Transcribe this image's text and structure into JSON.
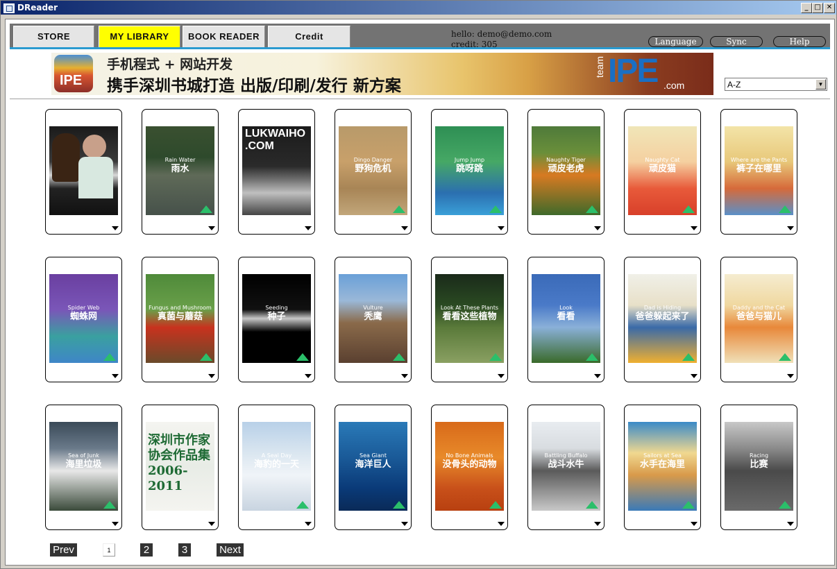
{
  "window": {
    "title": "DReader"
  },
  "nav": {
    "tabs": [
      {
        "label": "STORE",
        "active": false
      },
      {
        "label": "MY LIBRARY",
        "active": true
      },
      {
        "label": "BOOK READER",
        "active": false
      },
      {
        "label": "Credit",
        "active": false
      }
    ]
  },
  "user": {
    "hello": "hello: demo@demo.com",
    "credit": "credit: 305"
  },
  "actions": {
    "language": "Language",
    "sync": "Sync",
    "help": "Help"
  },
  "banner": {
    "logo_text": "IPE",
    "line1": "手机程式 + 网站开发",
    "line2": "携手深圳书城打造 出版/印刷/发行 新方案",
    "brand_team": "team",
    "brand_ipe": "IPE",
    "brand_com": ".com"
  },
  "sort": {
    "selected": "A-Z"
  },
  "books": [
    {
      "en": "",
      "cn": "",
      "bg": "linear-gradient(#1a1a1a,#3a3a3a 40%,#d8d8d8 55%,#222 70%,#111)",
      "special": "horse"
    },
    {
      "en": "Rain Water",
      "cn": "雨水",
      "bg": "linear-gradient(#3a5030,#2e4a2c 35%,#5f6a58 55%,#46514a)"
    },
    {
      "en": "",
      "cn": "",
      "bg": "linear-gradient(#1b1b1b,#2a2a2a 45%,#707070 60%,#bfbfbf 75%,#444)",
      "special": "lukwaiho"
    },
    {
      "en": "Dingo Danger",
      "cn": "野狗危机",
      "bg": "linear-gradient(#b89a6a,#c8a06a 40%,#a88556 70%,#c1a67a)"
    },
    {
      "en": "Jump Jump",
      "cn": "跳呀跳",
      "bg": "linear-gradient(#2e8f54,#46a865 40%,#2b6fb0 75%,#3aa0d8)"
    },
    {
      "en": "Naughty Tiger",
      "cn": "顽皮老虎",
      "bg": "linear-gradient(#4f7a3a,#6a8f3a 30%,#d77a22 55%,#3f6a2a)"
    },
    {
      "en": "Naughty Cat",
      "cn": "顽皮猫",
      "bg": "linear-gradient(#f0e6b8,#f5d0a0 40%,#e85a3a 70%,#d8402a)"
    },
    {
      "en": "Where are the Pants",
      "cn": "裤子在哪里",
      "bg": "linear-gradient(#f3e4a8,#e8c87a 40%,#d66a3a 70%,#5a8fc8)"
    },
    {
      "en": "Spider Web",
      "cn": "蜘蛛网",
      "bg": "linear-gradient(#6a3fa0,#7a56b8 40%,#3aa0a0 70%,#3f86c8)"
    },
    {
      "en": "Fungus and Mushroom",
      "cn": "真菌与蘑菇",
      "bg": "linear-gradient(#4f8a3a,#6aa04a 40%,#c8321e 60%,#6a4a2a)"
    },
    {
      "en": "Seeding",
      "cn": "种子",
      "bg": "linear-gradient(#000,#111 40%,#c8c8c8 50%,#000 65%)"
    },
    {
      "en": "Vulture",
      "cn": "秃鹰",
      "bg": "linear-gradient(#6aa0d8,#9ab8d8 30%,#8a6a4a 55%,#5a4030)"
    },
    {
      "en": "Look At These Plants",
      "cn": "看看这些植物",
      "bg": "linear-gradient(#1a2a1a,#2a4a22 35%,#5a7a3a 60%,#8aa062)"
    },
    {
      "en": "Look",
      "cn": "看看",
      "bg": "linear-gradient(#3a6ab8,#4a7ac8 35%,#8ab0d8 60%,#3a6a2a)"
    },
    {
      "en": "Dad is Hiding",
      "cn": "爸爸躲起来了",
      "bg": "linear-gradient(#f0f0e8,#e8e0c8 35%,#3a6aa8 60%,#f0b030)"
    },
    {
      "en": "Daddy and the Cat",
      "cn": "爸爸与猫儿",
      "bg": "linear-gradient(#f5ecd0,#f0d8a0 35%,#e8883a 60%,#f0e0b8)"
    },
    {
      "en": "Sea of Junk",
      "cn": "海里垃圾",
      "bg": "linear-gradient(#3a4a58,#6a7a8a 30%,#e8e8e8 55%,#3a4a3a)"
    },
    {
      "en": "",
      "cn": "",
      "bg": "linear-gradient(#f4f4f0,#e8ece6 50%,#f4f4f0)",
      "special": "szwriters"
    },
    {
      "en": "A Seal Day",
      "cn": "海豹的一天",
      "bg": "linear-gradient(#b8d0e8,#dae6f0 35%,#f0f4f8 60%,#c8d4e0)"
    },
    {
      "en": "Sea Giant",
      "cn": "海洋巨人",
      "bg": "linear-gradient(#2a7ab8,#1a5a98 40%,#0a3a78 75%,#0a2a58)"
    },
    {
      "en": "No Bone Animals",
      "cn": "没骨头的动物",
      "bg": "linear-gradient(#d86a1a,#e88a2a 40%,#c8501a 75%,#b84010)"
    },
    {
      "en": "Battling Buffalo",
      "cn": "战斗水牛",
      "bg": "linear-gradient(#e8ecf0,#d8dce0 30%,#5a5a5a 55%,#c8c8c8)"
    },
    {
      "en": "Sailors at Sea",
      "cn": "水手在海里",
      "bg": "linear-gradient(#3a8ac8,#f0d890 35%,#d89a4a 60%,#3a7ab8)"
    },
    {
      "en": "Racing",
      "cn": "比赛",
      "bg": "linear-gradient(#c8c8c8,#8a8a8a 30%,#4a4a4a 55%,#6a6a6a)"
    }
  ],
  "pager": {
    "prev": "Prev",
    "pages": [
      "1",
      "2",
      "3"
    ],
    "current": "1",
    "next": "Next"
  },
  "book_special": {
    "lukwaiho": "LUKWAIHO .COM",
    "szwriters": "深圳市作家协会作品集2006-2011"
  }
}
